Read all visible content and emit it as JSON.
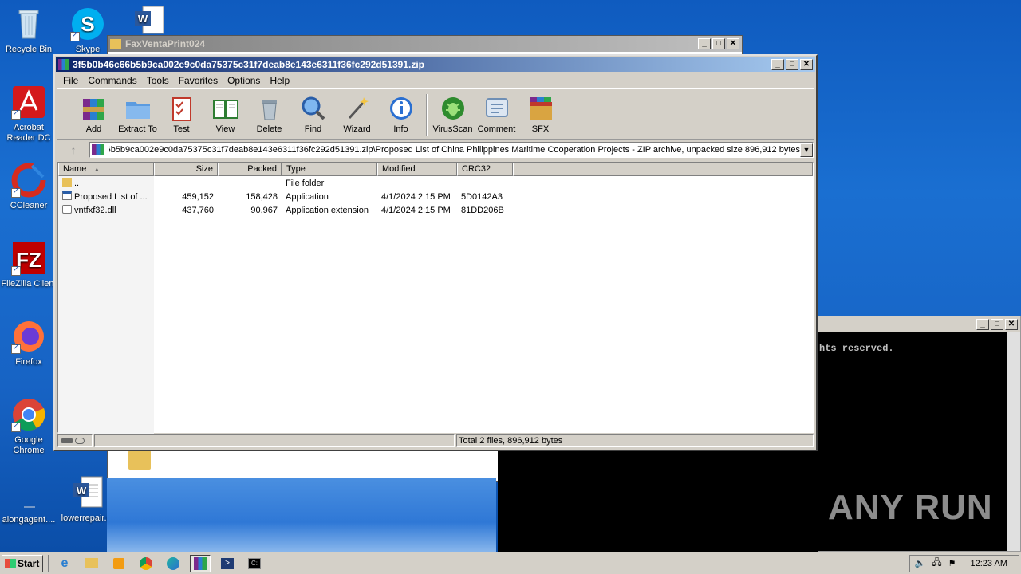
{
  "desktop": {
    "icons": [
      {
        "label": "Recycle Bin"
      },
      {
        "label": "Skype"
      },
      {
        "label": "Acrobat Reader DC"
      },
      {
        "label": "CCleaner"
      },
      {
        "label": "FileZilla Client"
      },
      {
        "label": "Firefox"
      },
      {
        "label": "Google Chrome"
      },
      {
        "label": "alongagent...."
      },
      {
        "label": "lowerrepair.rtf"
      }
    ]
  },
  "fax_window": {
    "title": "FaxVentaPrint024"
  },
  "cmd_window": {
    "text": "hts reserved."
  },
  "winrar": {
    "title": "3f5b0b46c66b5b9ca002e9c0da75375c31f7deab8e143e6311f36fc292d51391.zip",
    "menu": [
      "File",
      "Commands",
      "Tools",
      "Favorites",
      "Options",
      "Help"
    ],
    "toolbar": [
      "Add",
      "Extract To",
      "Test",
      "View",
      "Delete",
      "Find",
      "Wizard",
      "Info",
      "VirusScan",
      "Comment",
      "SFX"
    ],
    "address": "‎6b5b9ca002e9c0da75375c31f7deab8e143e6311f36fc292d51391.zip\\Proposed List of China Philippines Maritime Cooperation Projects - ZIP archive, unpacked size 896,912 bytes",
    "columns": {
      "name": "Name",
      "size": "Size",
      "packed": "Packed",
      "type": "Type",
      "modified": "Modified",
      "crc": "CRC32"
    },
    "files": [
      {
        "name": "..",
        "size": "",
        "packed": "",
        "type": "File folder",
        "modified": "",
        "crc": ""
      },
      {
        "name": "Proposed List of ...",
        "size": "459,152",
        "packed": "158,428",
        "type": "Application",
        "modified": "4/1/2024 2:15 PM",
        "crc": "5D0142A3"
      },
      {
        "name": "vntfxf32.dll",
        "size": "437,760",
        "packed": "90,967",
        "type": "Application extension",
        "modified": "4/1/2024 2:15 PM",
        "crc": "81DD206B"
      }
    ],
    "status": "Total 2 files, 896,912 bytes"
  },
  "taskbar": {
    "start": "Start",
    "clock": "12:23 AM"
  },
  "watermark": "ANY RUN"
}
